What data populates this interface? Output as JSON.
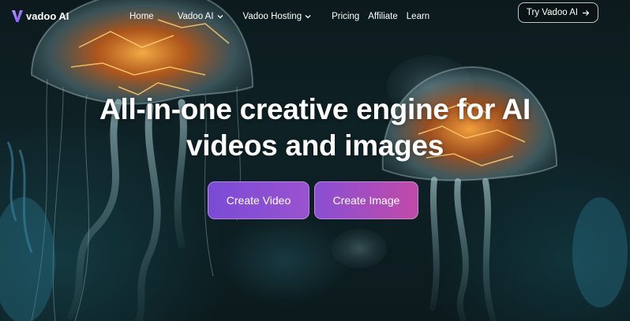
{
  "brand": {
    "name": "vadoo AI"
  },
  "nav": {
    "items": [
      {
        "label": "Home",
        "has_dropdown": false
      },
      {
        "label": "Vadoo AI",
        "has_dropdown": true
      },
      {
        "label": "Vadoo Hosting",
        "has_dropdown": true
      },
      {
        "label": "Pricing",
        "has_dropdown": false
      },
      {
        "label": "Affiliate",
        "has_dropdown": false
      },
      {
        "label": "Learn",
        "has_dropdown": false
      }
    ],
    "cta": {
      "label": "Try Vadoo AI",
      "icon": "arrow-right-icon"
    }
  },
  "hero": {
    "headline_line1": "All-in-one creative engine for AI",
    "headline_line2": "videos and images",
    "buttons": {
      "create_video": "Create Video",
      "create_image": "Create Image"
    }
  },
  "colors": {
    "background": "#0e2226",
    "button_video_start": "#7a4bd6",
    "button_video_end": "#9a52d0",
    "button_image_start": "#8a4fd4",
    "button_image_end": "#c24aa8",
    "glow": "#ff8a2a"
  }
}
